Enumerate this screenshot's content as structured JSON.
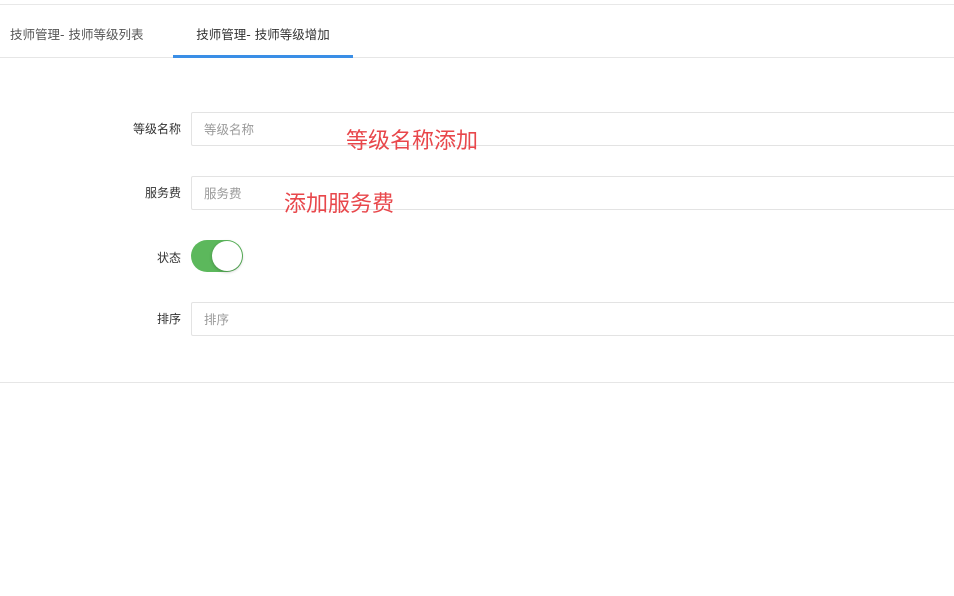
{
  "tabs": [
    {
      "label": "技师管理- 技师等级列表",
      "active": false
    },
    {
      "label": "技师管理- 技师等级增加",
      "active": true
    }
  ],
  "form": {
    "level_name": {
      "label": "等级名称",
      "placeholder": "等级名称",
      "value": ""
    },
    "service_fee": {
      "label": "服务费",
      "placeholder": "服务费",
      "value": ""
    },
    "status": {
      "label": "状态",
      "on": true
    },
    "sort": {
      "label": "排序",
      "placeholder": "排序",
      "value": ""
    }
  },
  "annotations": {
    "level_name": "等级名称添加",
    "service_fee": "添加服务费"
  },
  "colors": {
    "accent": "#3a8ee6",
    "toggle_on": "#5cb85c",
    "annotation": "#e8474b"
  }
}
